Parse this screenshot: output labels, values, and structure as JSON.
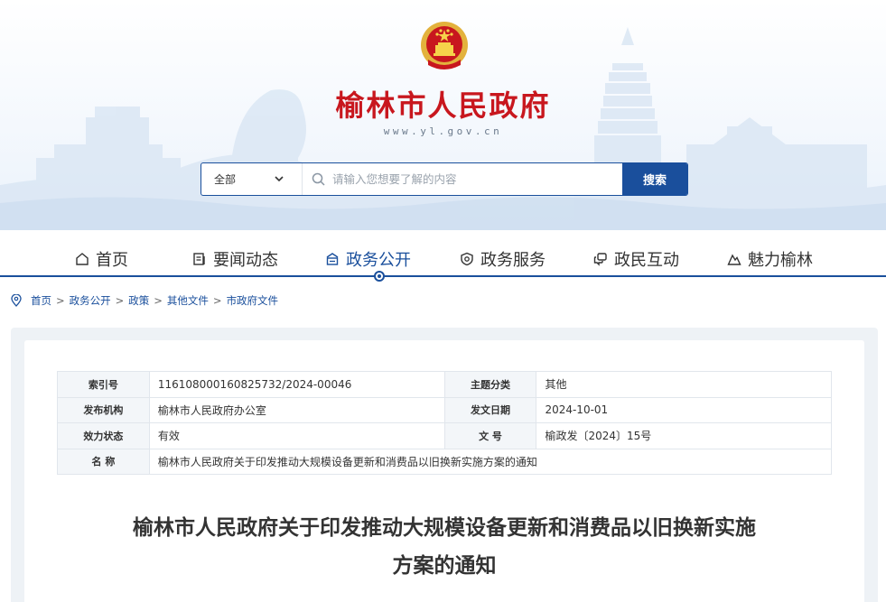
{
  "header": {
    "site_title": "榆林市人民政府",
    "site_url": "www.yl.gov.cn"
  },
  "search": {
    "scope": "全部",
    "placeholder": "请输入您想要了解的内容",
    "button_label": "搜索"
  },
  "nav": {
    "items": [
      {
        "label": "首页",
        "icon": "home-icon"
      },
      {
        "label": "要闻动态",
        "icon": "news-icon"
      },
      {
        "label": "政务公开",
        "icon": "open-government-icon",
        "active": true
      },
      {
        "label": "政务服务",
        "icon": "service-shield-icon"
      },
      {
        "label": "政民互动",
        "icon": "chat-icon"
      },
      {
        "label": "魅力榆林",
        "icon": "mountain-icon"
      }
    ]
  },
  "breadcrumb": {
    "items": [
      "首页",
      "政务公开",
      "政策",
      "其他文件",
      "市政府文件"
    ],
    "separator": ">"
  },
  "meta": {
    "index_no_label": "索引号",
    "index_no": "116108000160825732/2024-00046",
    "topic_label": "主题分类",
    "topic": "其他",
    "publisher_label": "发布机构",
    "publisher": "榆林市人民政府办公室",
    "issue_date_label": "发文日期",
    "issue_date": "2024-10-01",
    "status_label": "效力状态",
    "status": "有效",
    "doc_no_label": "文 号",
    "doc_no": "榆政发〔2024〕15号",
    "name_label": "名 称",
    "name": "榆林市人民政府关于印发推动大规模设备更新和消费品以旧换新实施方案的通知"
  },
  "document": {
    "title_line1": "榆林市人民政府关于印发推动大规模设备更新和消费品以旧换新实施",
    "title_line2": "方案的通知"
  },
  "colors": {
    "brand_blue": "#1a4f9c",
    "title_red": "#c8171e",
    "emblem_gold": "#e3b23c"
  }
}
